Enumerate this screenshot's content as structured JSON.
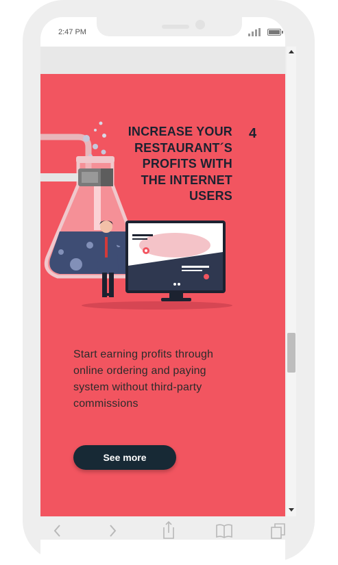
{
  "status_bar": {
    "time": "2:47 PM"
  },
  "card": {
    "headline": "INCREASE YOUR RESTAURANT´S PROFITS WITH THE INTERNET USERS",
    "step_number": "4",
    "description": "Start earning profits through online ordering and paying system without third-party commissions",
    "cta_label": "See more"
  },
  "colors": {
    "card_background": "#f25560",
    "button_background": "#172935",
    "headline_text": "#1c2230"
  },
  "icons": [
    "back-icon",
    "forward-icon",
    "share-icon",
    "bookmarks-icon",
    "tabs-icon",
    "signal-icon",
    "battery-icon"
  ]
}
